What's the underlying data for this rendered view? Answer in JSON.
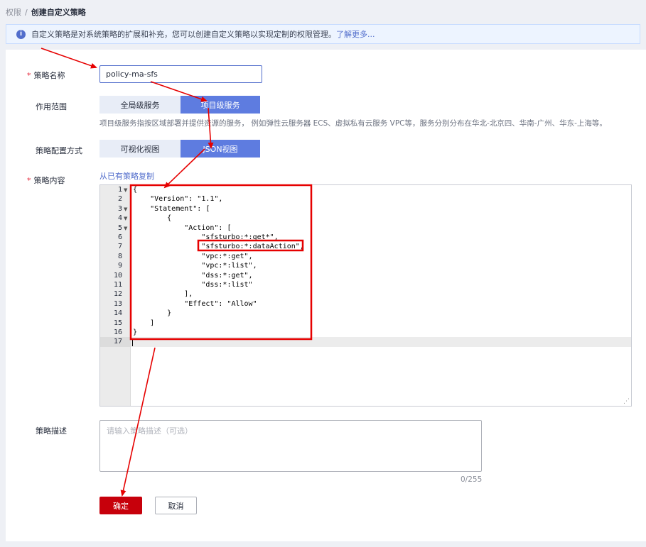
{
  "breadcrumb": {
    "parent": "权限",
    "separator": "/",
    "current": "创建自定义策略"
  },
  "banner": {
    "text": "自定义策略是对系统策略的扩展和补充，您可以创建自定义策略以实现定制的权限管理。",
    "link": "了解更多..."
  },
  "form": {
    "name_label": "策略名称",
    "name_value": "policy-ma-sfs",
    "scope_label": "作用范围",
    "scope_options": [
      "全局级服务",
      "项目级服务"
    ],
    "scope_selected": "项目级服务",
    "scope_hint": "项目级服务指按区域部署并提供资源的服务， 例如弹性云服务器 ECS、虚拟私有云服务 VPC等，服务分别分布在华北-北京四、华南-广州、华东-上海等。",
    "mode_label": "策略配置方式",
    "mode_options": [
      "可视化视图",
      "JSON视图"
    ],
    "mode_selected": "JSON视图",
    "content_label": "策略内容",
    "copy_link": "从已有策略复制",
    "desc_label": "策略描述",
    "desc_placeholder": "请输入策略描述（可选）",
    "desc_counter": "0/255",
    "confirm_button": "确定",
    "cancel_button": "取消"
  },
  "editor": {
    "line_numbers": [
      "1",
      "2",
      "3",
      "4",
      "5",
      "6",
      "7",
      "8",
      "9",
      "10",
      "11",
      "12",
      "13",
      "14",
      "15",
      "16",
      "17"
    ],
    "lines": [
      "{",
      "    \"Version\": \"1.1\",",
      "    \"Statement\": [",
      "        {",
      "            \"Action\": [",
      "                \"sfsturbo:*:get*\",",
      "                \"sfsturbo:*:dataAction\",",
      "                \"vpc:*:get\",",
      "                \"vpc:*:list\",",
      "                \"dss:*:get\",",
      "                \"dss:*:list\"",
      "            ],",
      "            \"Effect\": \"Allow\"",
      "        }",
      "    ]",
      "}",
      ""
    ],
    "fold_lines": [
      1,
      3,
      4,
      5
    ],
    "active_line": 17
  },
  "colors": {
    "primary_button": "#c7000b",
    "selected_segment": "#5e7ce0",
    "link": "#526ecc",
    "annotation": "#e60000"
  }
}
